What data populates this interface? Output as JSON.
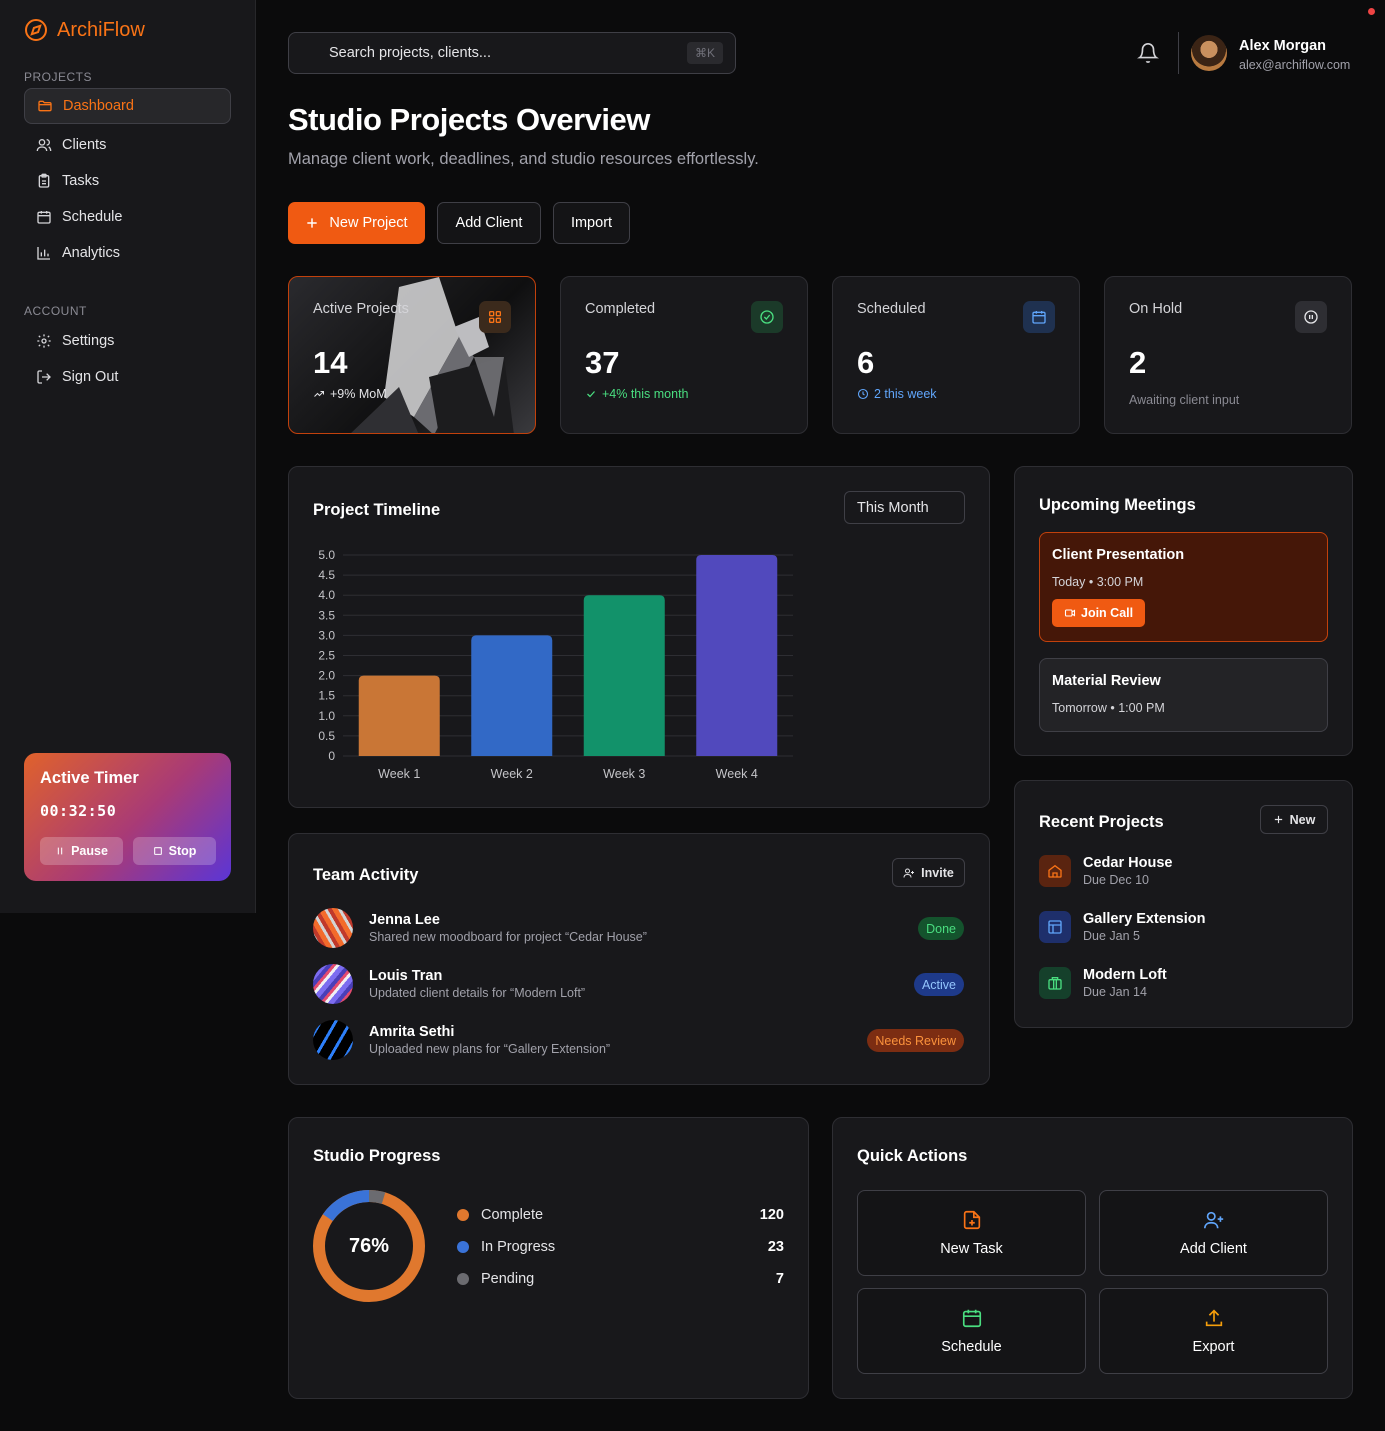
{
  "brand": {
    "name": "ArchiFlow",
    "color": "#f97316"
  },
  "sidebar": {
    "projects_label": "PROJECTS",
    "account_label": "ACCOUNT",
    "items": [
      {
        "label": "Dashboard",
        "icon": "folder-icon",
        "active": true
      },
      {
        "label": "Clients",
        "icon": "users-icon"
      },
      {
        "label": "Tasks",
        "icon": "clipboard-icon"
      },
      {
        "label": "Schedule",
        "icon": "calendar-icon"
      },
      {
        "label": "Analytics",
        "icon": "bar-chart-icon"
      }
    ],
    "account_items": [
      {
        "label": "Settings",
        "icon": "gear-icon"
      },
      {
        "label": "Sign Out",
        "icon": "sign-out-icon"
      }
    ],
    "timer": {
      "title": "Active Timer",
      "value": "00:32:50",
      "pause_label": "Pause",
      "stop_label": "Stop"
    }
  },
  "header": {
    "search_placeholder": "Search projects, clients...",
    "shortcut": "⌘K",
    "user": {
      "name": "Alex Morgan",
      "email": "alex@archiflow.com"
    }
  },
  "page": {
    "title": "Studio Projects Overview",
    "subtitle": "Manage client work, deadlines, and studio resources effortlessly.",
    "actions": {
      "new_project": "New Project",
      "add_client": "Add Client",
      "import": "Import"
    }
  },
  "stats": [
    {
      "label": "Active Projects",
      "value": "14",
      "note": "+9% MoM",
      "note_color": "#e4e4e7"
    },
    {
      "label": "Completed",
      "value": "37",
      "note": "+4% this month",
      "note_color": "#4ade80"
    },
    {
      "label": "Scheduled",
      "value": "6",
      "note": "2 this week",
      "note_color": "#60a5fa"
    },
    {
      "label": "On Hold",
      "value": "2",
      "note": "Awaiting client input",
      "note_color": "#8a8a93"
    }
  ],
  "timeline": {
    "title": "Project Timeline",
    "range": "This Month"
  },
  "chart_data": {
    "type": "bar",
    "categories": [
      "Week 1",
      "Week 2",
      "Week 3",
      "Week 4"
    ],
    "values": [
      2,
      3,
      4,
      5
    ],
    "colors": [
      "#c97636",
      "#3269c6",
      "#12926a",
      "#5149bd"
    ],
    "ylim": [
      0,
      5
    ],
    "yticks": [
      "0",
      "0.5",
      "1.0",
      "1.5",
      "2.0",
      "2.5",
      "3.0",
      "3.5",
      "4.0",
      "4.5",
      "5.0"
    ],
    "grid": true
  },
  "meetings": {
    "title": "Upcoming Meetings",
    "items": [
      {
        "title": "Client Presentation",
        "day": "Today",
        "time": "3:00 PM",
        "join_label": "Join Call"
      },
      {
        "title": "Material Review",
        "day": "Tomorrow",
        "time": "1:00 PM"
      }
    ]
  },
  "recent_projects": {
    "title": "Recent Projects",
    "new_label": "New",
    "items": [
      {
        "name": "Cedar House",
        "due": "Due Dec 10",
        "icon": "home-icon"
      },
      {
        "name": "Gallery Extension",
        "due": "Due Jan 5",
        "icon": "layout-icon"
      },
      {
        "name": "Modern Loft",
        "due": "Due Jan 14",
        "icon": "building-icon"
      }
    ]
  },
  "team_activity": {
    "title": "Team Activity",
    "invite_label": "Invite",
    "items": [
      {
        "name": "Jenna Lee",
        "desc": "Shared new moodboard for project “Cedar House”",
        "status": "Done"
      },
      {
        "name": "Louis Tran",
        "desc": "Updated client details for “Modern Loft”",
        "status": "Active"
      },
      {
        "name": "Amrita Sethi",
        "desc": "Uploaded new plans for “Gallery Extension”",
        "status": "Needs Review"
      }
    ]
  },
  "studio_progress": {
    "title": "Studio Progress",
    "percent": "76%",
    "legend": [
      {
        "label": "Complete",
        "value": "120",
        "color": "#e0782e"
      },
      {
        "label": "In Progress",
        "value": "23",
        "color": "#3a73d8"
      },
      {
        "label": "Pending",
        "value": "7",
        "color": "#6b6b70"
      }
    ]
  },
  "quick_actions": {
    "title": "Quick Actions",
    "items": [
      {
        "label": "New Task",
        "icon": "file-plus-icon"
      },
      {
        "label": "Add Client",
        "icon": "user-plus-icon"
      },
      {
        "label": "Schedule",
        "icon": "calendar-icon"
      },
      {
        "label": "Export",
        "icon": "upload-icon"
      }
    ]
  }
}
